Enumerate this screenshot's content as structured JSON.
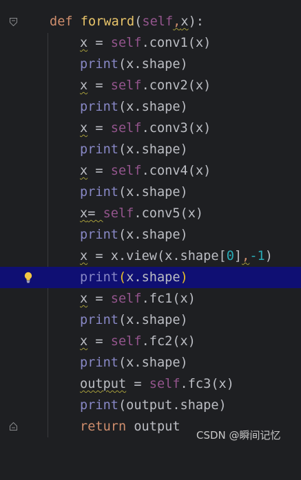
{
  "code": {
    "l1": {
      "def": "def",
      "name": "forward",
      "open": "(",
      "self": "self",
      "comma": ",",
      "arg": "x",
      "close": "):"
    },
    "l2": {
      "var": "x",
      "eq": " = ",
      "self": "self",
      "attr": ".conv1(x)"
    },
    "l3": {
      "fn": "print",
      "rest": "(x.shape)"
    },
    "l4": {
      "var": "x",
      "eq": " = ",
      "self": "self",
      "attr": ".conv2(x)"
    },
    "l5": {
      "fn": "print",
      "rest": "(x.shape)"
    },
    "l6": {
      "var": "x",
      "eq": " = ",
      "self": "self",
      "attr": ".conv3(x)"
    },
    "l7": {
      "fn": "print",
      "rest": "(x.shape)"
    },
    "l8": {
      "var": "x",
      "eq": " = ",
      "self": "self",
      "attr": ".conv4(x)"
    },
    "l9": {
      "fn": "print",
      "rest": "(x.shape)"
    },
    "l10": {
      "var": "x",
      "eq": "= ",
      "self": "self",
      "attr": ".conv5(x)"
    },
    "l11": {
      "fn": "print",
      "rest": "(x.shape)"
    },
    "l12": {
      "var": "x",
      "mid": " = x.view(x.shape[",
      "idx": "0",
      "close": "]",
      "comma": ",",
      "neg": "-1",
      "end": ")"
    },
    "l13": {
      "fn": "print",
      "open": "(",
      "mid": "x.shape",
      "close": ")"
    },
    "l14": {
      "var": "x",
      "eq": " = ",
      "self": "self",
      "attr": ".fc1(x)"
    },
    "l15": {
      "fn": "print",
      "rest": "(x.shape)"
    },
    "l16": {
      "var": "x",
      "eq": " = ",
      "self": "self",
      "attr": ".fc2(x)"
    },
    "l17": {
      "fn": "print",
      "rest": "(x.shape)"
    },
    "l18": {
      "var": "output",
      "eq": " = ",
      "self": "self",
      "attr": ".fc3(x)"
    },
    "l19": {
      "fn": "print",
      "rest": "(output.shape)"
    },
    "l20": {
      "kw": "return",
      "rest": " output"
    }
  },
  "current_line": 13,
  "icons": {
    "fold": "fold-marker-icon",
    "bulb": "lightbulb-icon"
  },
  "colors": {
    "background": "#1e1f22",
    "current_line": "#0f0f73",
    "keyword": "#cf8e6d",
    "self": "#94558d",
    "builtin": "#8888c6",
    "number": "#2aacb8",
    "function_name": "#e8c46a"
  },
  "watermark": "CSDN @瞬间记忆"
}
